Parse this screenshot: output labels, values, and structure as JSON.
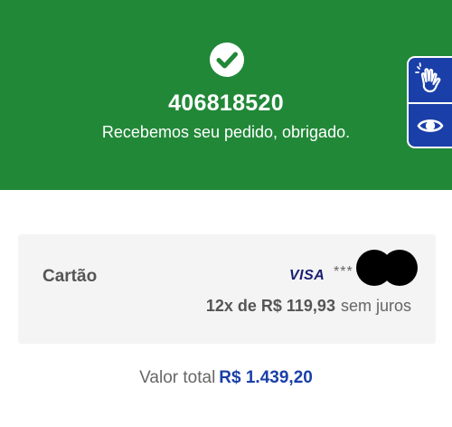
{
  "confirmation": {
    "order_number": "406818520",
    "message": "Recebemos seu pedido, obrigado."
  },
  "accessibility": {
    "sign_language_icon": "sign-language-hand-icon",
    "visual_icon": "eye-icon"
  },
  "payment": {
    "method_label": "Cartão",
    "card_brand": "VISA",
    "masked_number": "***",
    "installments": "12x de R$ 119,93",
    "interest": "sem juros"
  },
  "total": {
    "label": "Valor total",
    "value": "R$ 1.439,20"
  },
  "colors": {
    "banner": "#218838",
    "accent_blue": "#1a3fa8",
    "card_background": "#f4f4f4"
  }
}
